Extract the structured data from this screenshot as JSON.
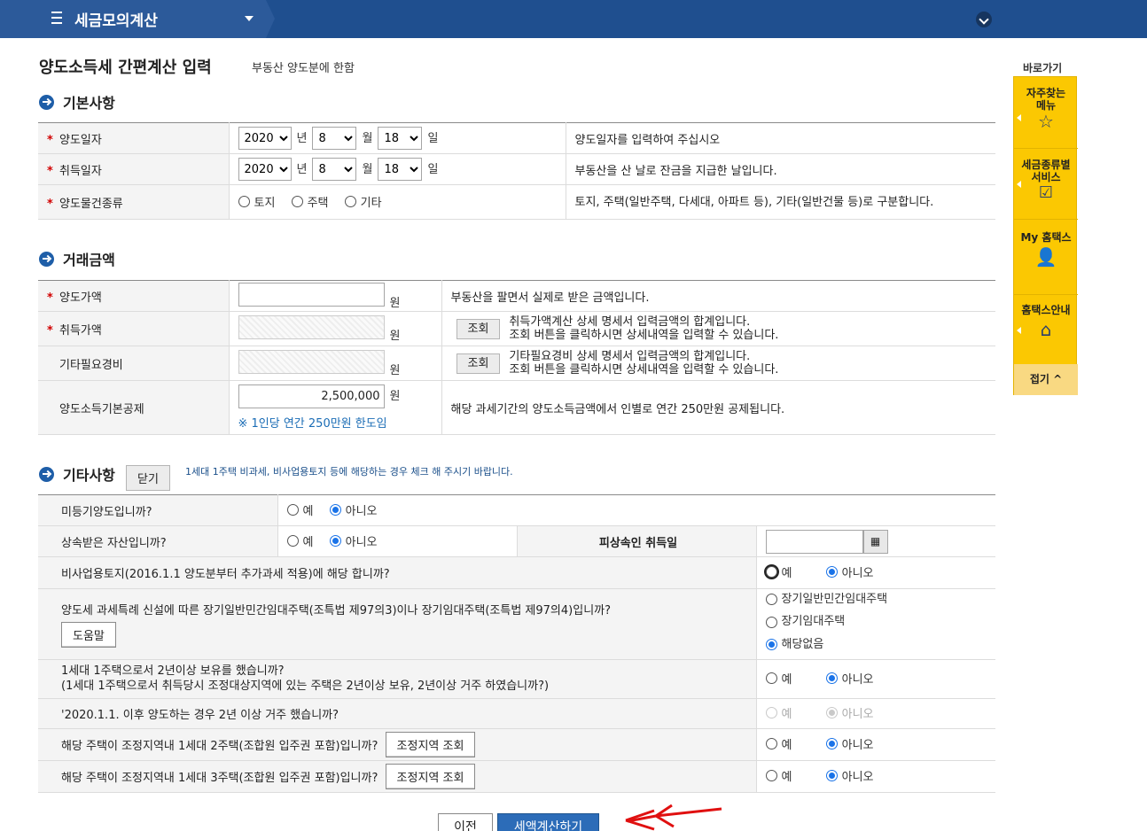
{
  "topbar": {
    "menu_title": "세금모의계산"
  },
  "page": {
    "title": "양도소득세 간편계산 입력",
    "subtitle": "부동산 양도분에 한함"
  },
  "sections": {
    "basic": "기본사항",
    "amount": "거래금액",
    "etc": "기타사항",
    "etc_close_btn": "닫기",
    "etc_note": "1세대 1주택 비과세, 비사업용토지 등에 해당하는 경우 체크 해 주시기 바랍니다."
  },
  "basic": {
    "req_mark": "*",
    "year_unit": "년",
    "month_unit": "월",
    "day_unit": "일",
    "transfer_date": {
      "label": "양도일자",
      "year": "2020",
      "month": "8",
      "day": "18",
      "desc": "양도일자를 입력하여 주십시오"
    },
    "acquire_date": {
      "label": "취득일자",
      "year": "2020",
      "month": "8",
      "day": "18",
      "desc": "부동산을 산 날로 잔금을 지급한 날입니다."
    },
    "property_type": {
      "label": "양도물건종류",
      "options": [
        "토지",
        "주택",
        "기타"
      ],
      "desc": "토지, 주택(일반주택, 다세대, 아파트 등), 기타(일반건물 등)로 구분합니다."
    }
  },
  "amount": {
    "won": "원",
    "lookup_btn": "조회",
    "transfer_price": {
      "label": "양도가액",
      "value": "",
      "desc": "부동산을 팔면서 실제로 받은 금액입니다."
    },
    "acquire_price": {
      "label": "취득가액",
      "desc1": "취득가액계산 상세 명세서 입력금액의 합계입니다.",
      "desc2": "조회 버튼을 클릭하시면 상세내역을 입력할 수 있습니다."
    },
    "other_cost": {
      "label": "기타필요경비",
      "desc1": "기타필요경비 상세 명세서 입력금액의 합계입니다.",
      "desc2": "조회 버튼을 클릭하시면 상세내역을 입력할 수 있습니다."
    },
    "basic_deduction": {
      "label": "양도소득기본공제",
      "value": "2,500,000",
      "note": "※ 1인당 연간 250만원 한도임",
      "desc": "해당 과세기간의 양도소득금액에서 인별로 연간 250만원 공제됩니다."
    }
  },
  "etc": {
    "yes": "예",
    "no": "아니오",
    "q1": "미등기양도입니까?",
    "q2": "상속받은 자산입니까?",
    "q2_inherit_label": "피상속인 취득일",
    "q3": "비사업용토지(2016.1.1 양도분부터 추가과세 적용)에 해당 합니까?",
    "q4": "양도세 과세특례 신설에 따른 장기일반민간임대주택(조특법 제97의3)이나 장기임대주택(조특법 제97의4)입니까?",
    "q4_help": "도움말",
    "q4_options": [
      "장기일반민간임대주택",
      "장기임대주택",
      "해당없음"
    ],
    "q5_line1": "1세대 1주택으로서 2년이상 보유를 했습니까?",
    "q5_line2": "(1세대 1주택으로서 취득당시 조정대상지역에 있는 주택은 2년이상 보유, 2년이상 거주 하였습니까?)",
    "q6": "'2020.1.1. 이후 양도하는 경우 2년 이상 거주 했습니까?",
    "q7": "해당 주택이 조정지역내 1세대 2주택(조합원 입주권 포함)입니까?",
    "q8": "해당 주택이 조정지역내 1세대 3주택(조합원 입주권 포함)입니까?",
    "region_btn": "조정지역 조회"
  },
  "quick": {
    "title": "바로가기",
    "items": [
      {
        "label1": "자주찾는",
        "label2": "메뉴",
        "icon": "star-icon"
      },
      {
        "label1": "세금종류별",
        "label2": "서비스",
        "icon": "checkbox-icon"
      },
      {
        "label1": "My 홈택스",
        "label2": "",
        "icon": "person-icon"
      },
      {
        "label1": "홈택스안내",
        "label2": "",
        "icon": "home-icon"
      }
    ],
    "fold": "접기 ^"
  },
  "bottom": {
    "prev": "이전",
    "calc": "세액계산하기"
  },
  "colors": {
    "topbar": "#1f4f8f",
    "accent": "#1a73e8",
    "quick_bg": "#fbc802",
    "calc_btn": "#2c6cb8",
    "annotation": "#e01010"
  }
}
